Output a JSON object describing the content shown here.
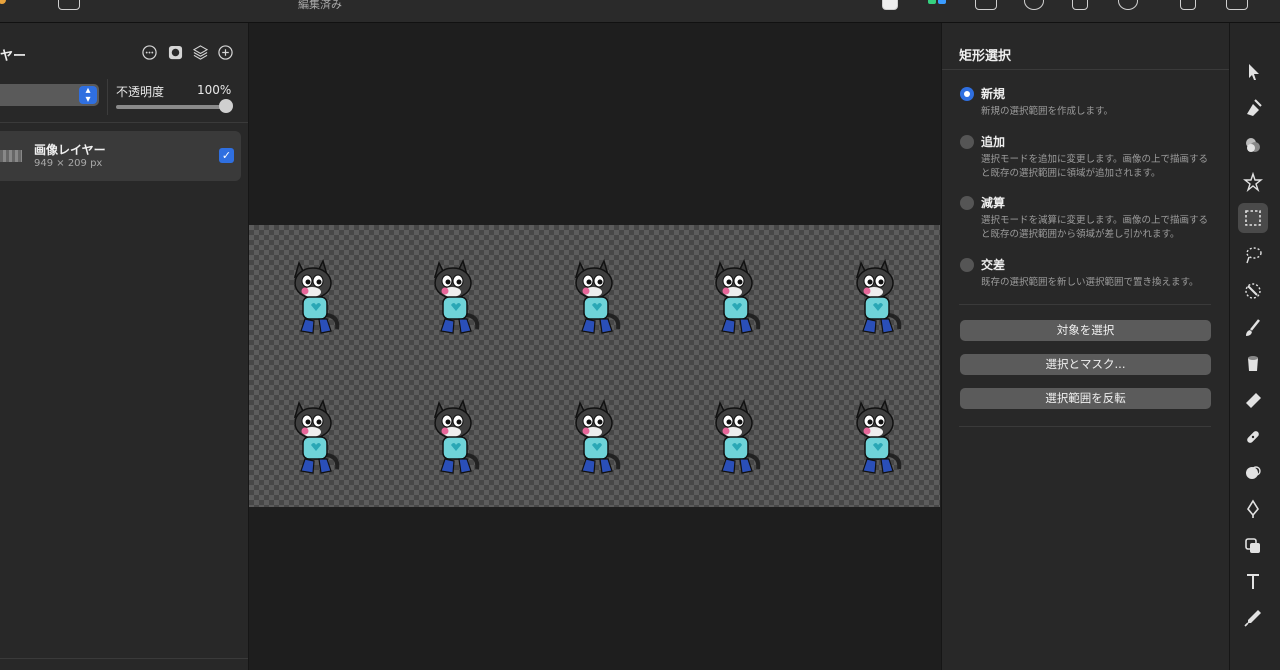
{
  "titlebar": {
    "status": "編集済み"
  },
  "layers_panel": {
    "title": "ヤー",
    "opacity_label": "不透明度",
    "opacity_value": "100%",
    "opacity_level": 1.0,
    "layer": {
      "name": "画像レイヤー",
      "size": "949 × 209 px",
      "visible": true
    }
  },
  "properties_panel": {
    "title": "矩形選択",
    "modes": [
      {
        "label": "新規",
        "description": "新規の選択範囲を作成します。",
        "selected": true
      },
      {
        "label": "追加",
        "description": "選択モードを追加に変更します。画像の上で描画すると既存の選択範囲に領域が追加されます。",
        "selected": false
      },
      {
        "label": "減算",
        "description": "選択モードを減算に変更します。画像の上で描画すると既存の選択範囲から領域が差し引かれます。",
        "selected": false
      },
      {
        "label": "交差",
        "description": "既存の選択範囲を新しい選択範囲で置き換えます。",
        "selected": false
      }
    ],
    "buttons": {
      "select_subject": "対象を選択",
      "select_and_mask": "選択とマスク...",
      "invert_selection": "選択範囲を反転"
    }
  },
  "tools": [
    {
      "name": "arrange-tool-icon"
    },
    {
      "name": "paint-select-tool-icon"
    },
    {
      "name": "color-adjust-tool-icon"
    },
    {
      "name": "effects-tool-icon"
    },
    {
      "name": "rectangle-select-tool-icon",
      "active": true
    },
    {
      "name": "lasso-select-tool-icon"
    },
    {
      "name": "magic-wand-tool-icon"
    },
    {
      "name": "brush-tool-icon"
    },
    {
      "name": "fill-tool-icon"
    },
    {
      "name": "eraser-tool-icon"
    },
    {
      "name": "retouch-tool-icon"
    },
    {
      "name": "clone-tool-icon"
    },
    {
      "name": "pen-tool-icon"
    },
    {
      "name": "shape-tool-icon"
    },
    {
      "name": "text-tool-icon"
    },
    {
      "name": "color-picker-tool-icon"
    }
  ],
  "colors": {
    "accent": "#2f6fe0",
    "panel": "#282828",
    "canvas": "#1e1e1e"
  }
}
